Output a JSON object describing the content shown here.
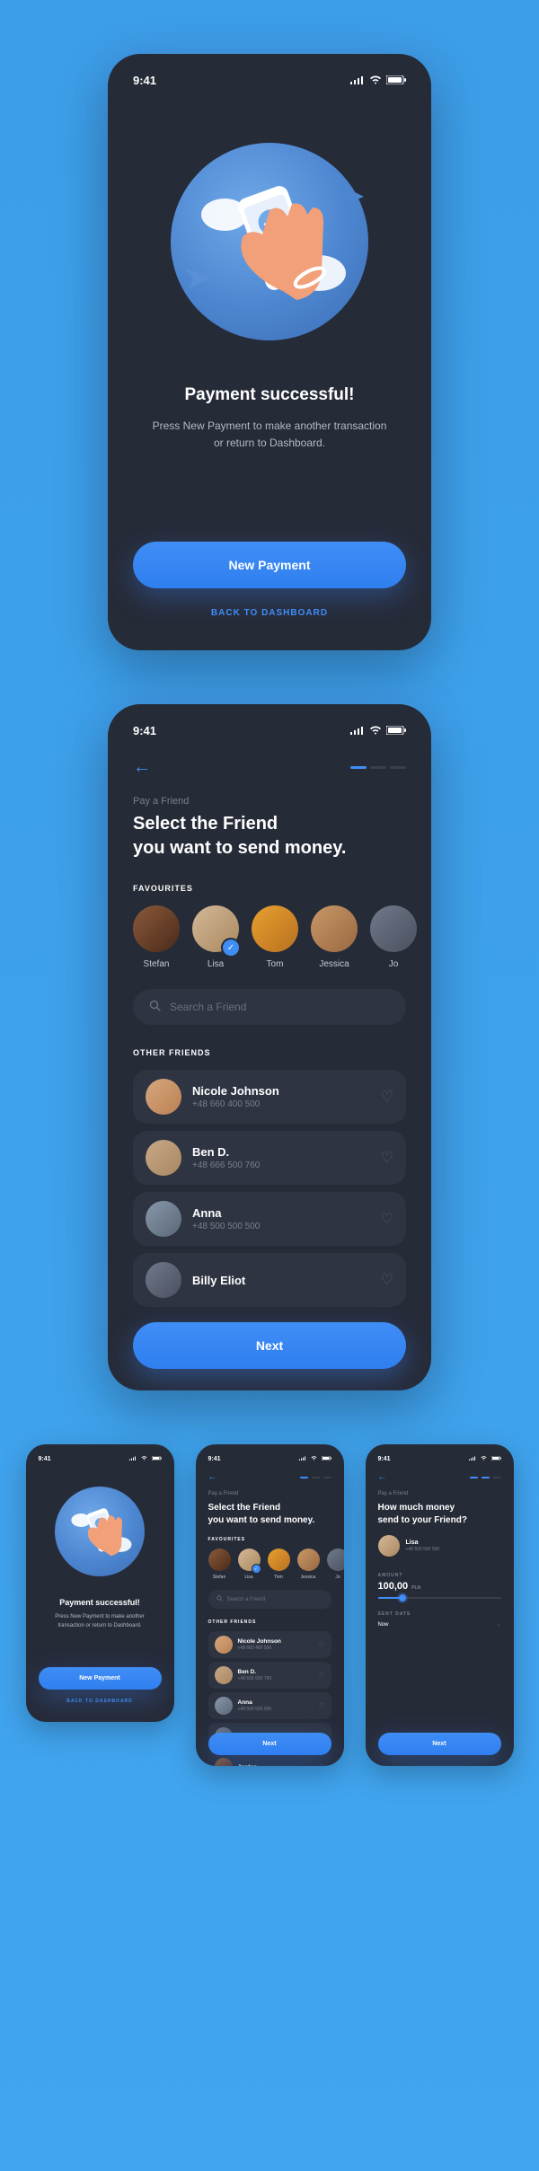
{
  "status": {
    "time": "9:41"
  },
  "screen1": {
    "title": "Payment successful!",
    "subtitle": "Press New Payment to make another transaction or return to Dashboard.",
    "primary": "New Payment",
    "link": "BACK TO DASHBOARD"
  },
  "screen2": {
    "breadcrumb": "Pay a Friend",
    "title_line1": "Select the Friend",
    "title_line2": "you want to send money.",
    "favourites_label": "FAVOURITES",
    "favourites": [
      {
        "name": "Stefan",
        "selected": false
      },
      {
        "name": "Lisa",
        "selected": true
      },
      {
        "name": "Tom",
        "selected": false
      },
      {
        "name": "Jessica",
        "selected": false
      },
      {
        "name": "Jo",
        "selected": false
      }
    ],
    "search_placeholder": "Search a Friend",
    "other_label": "OTHER FRIENDS",
    "friends": [
      {
        "name": "Nicole Johnson",
        "phone": "+48 660 400 500"
      },
      {
        "name": "Ben D.",
        "phone": "+48 666 500 760"
      },
      {
        "name": "Anna",
        "phone": "+48 500 500 500"
      },
      {
        "name": "Billy Eliot",
        "phone": ""
      },
      {
        "name": "Jordan",
        "phone": ""
      }
    ],
    "next": "Next"
  },
  "screen3": {
    "breadcrumb": "Pay a Friend",
    "title_line1": "How much money",
    "title_line2": "send to your Friend?",
    "friend_name": "Lisa",
    "friend_phone": "+48 500 500 500",
    "amount_label": "AMOUNT",
    "amount_value": "100,00",
    "currency": "PLN",
    "sent_date_label": "SENT DATE",
    "sent_date_value": "Now",
    "next": "Next"
  }
}
